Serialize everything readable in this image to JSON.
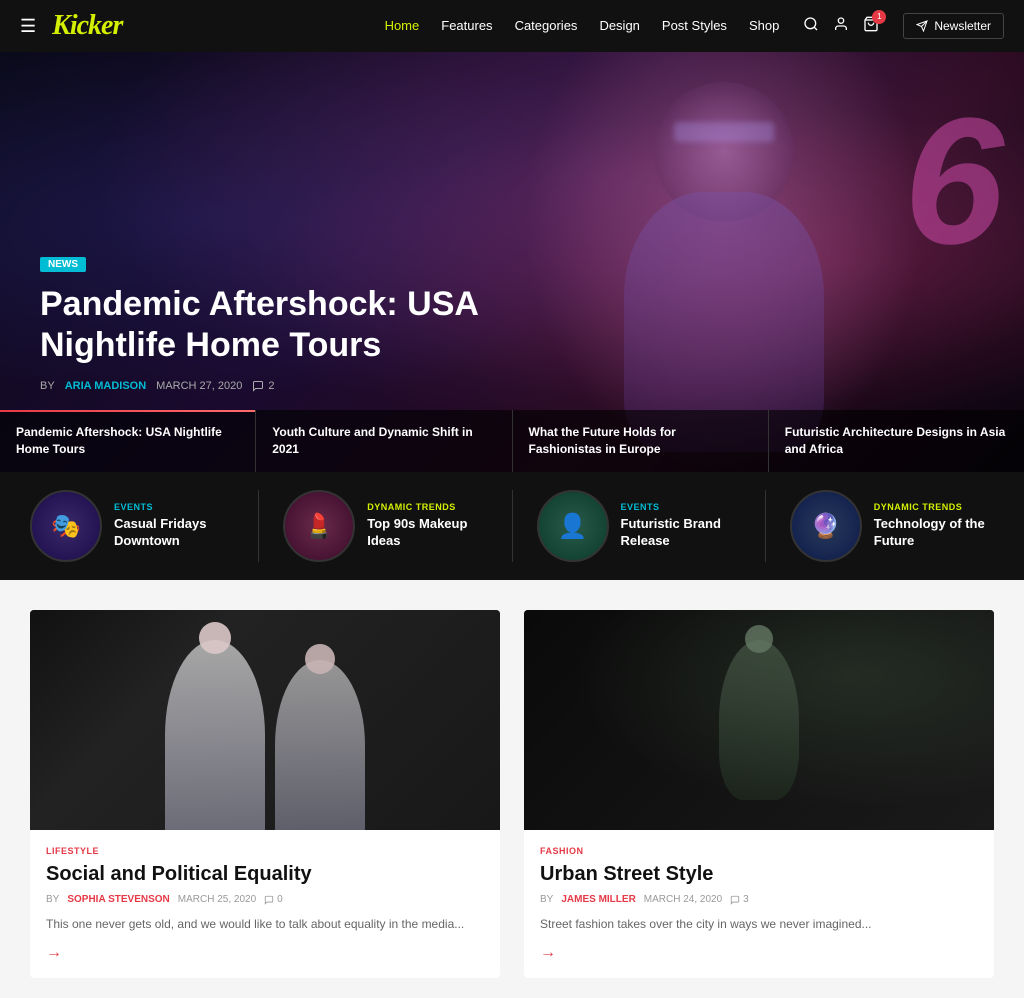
{
  "brand": {
    "logo": "Kicker"
  },
  "navbar": {
    "hamburger_label": "☰",
    "links": [
      {
        "label": "Home",
        "active": true
      },
      {
        "label": "Features",
        "active": false
      },
      {
        "label": "Categories",
        "active": false
      },
      {
        "label": "Design",
        "active": false
      },
      {
        "label": "Post Styles",
        "active": false
      },
      {
        "label": "Shop",
        "active": false
      }
    ],
    "newsletter_label": "Newsletter",
    "cart_count": "1"
  },
  "hero": {
    "badge": "NEWS",
    "title": "Pandemic Aftershock: USA Nightlife Home Tours",
    "author": "ARIA MADISON",
    "date": "MARCH 27, 2020",
    "comments": "2",
    "neon_char": "6",
    "slides": [
      {
        "title": "Pandemic Aftershock: USA Nightlife Home Tours"
      },
      {
        "title": "Youth Culture and Dynamic Shift in 2021"
      },
      {
        "title": "What the Future Holds for Fashionistas in Europe"
      },
      {
        "title": "Futuristic Architecture Designs in Asia and Africa"
      }
    ]
  },
  "trending": {
    "items": [
      {
        "category": "EVENTS",
        "category_class": "cat-events",
        "title": "Casual Fridays Downtown",
        "thumb_class": "circle-events",
        "thumb_emoji": "🎭"
      },
      {
        "category": "DYNAMIC TRENDS",
        "category_class": "cat-dynamic",
        "title": "Top 90s Makeup Ideas",
        "thumb_class": "circle-makeup",
        "thumb_emoji": "💄"
      },
      {
        "category": "EVENTS",
        "category_class": "cat-events",
        "title": "Futuristic Brand Release",
        "thumb_class": "circle-brand",
        "thumb_emoji": "👤"
      },
      {
        "category": "DYNAMIC TRENDS",
        "category_class": "cat-dynamic",
        "title": "Technology of the Future",
        "thumb_class": "circle-tech",
        "thumb_emoji": "🔮"
      }
    ]
  },
  "articles": [
    {
      "category": "LIFESTYLE",
      "title": "Social and Political Equality",
      "author": "SOPHIA STEVENSON",
      "date": "MARCH 25, 2020",
      "comments": "0",
      "excerpt": "This one never gets old, and we would like to talk about equality in the media..."
    },
    {
      "category": "FASHION",
      "title": "Urban Street Style",
      "author": "JAMES MILLER",
      "date": "MARCH 24, 2020",
      "comments": "3",
      "excerpt": "Street fashion takes over the city in ways we never imagined..."
    }
  ]
}
